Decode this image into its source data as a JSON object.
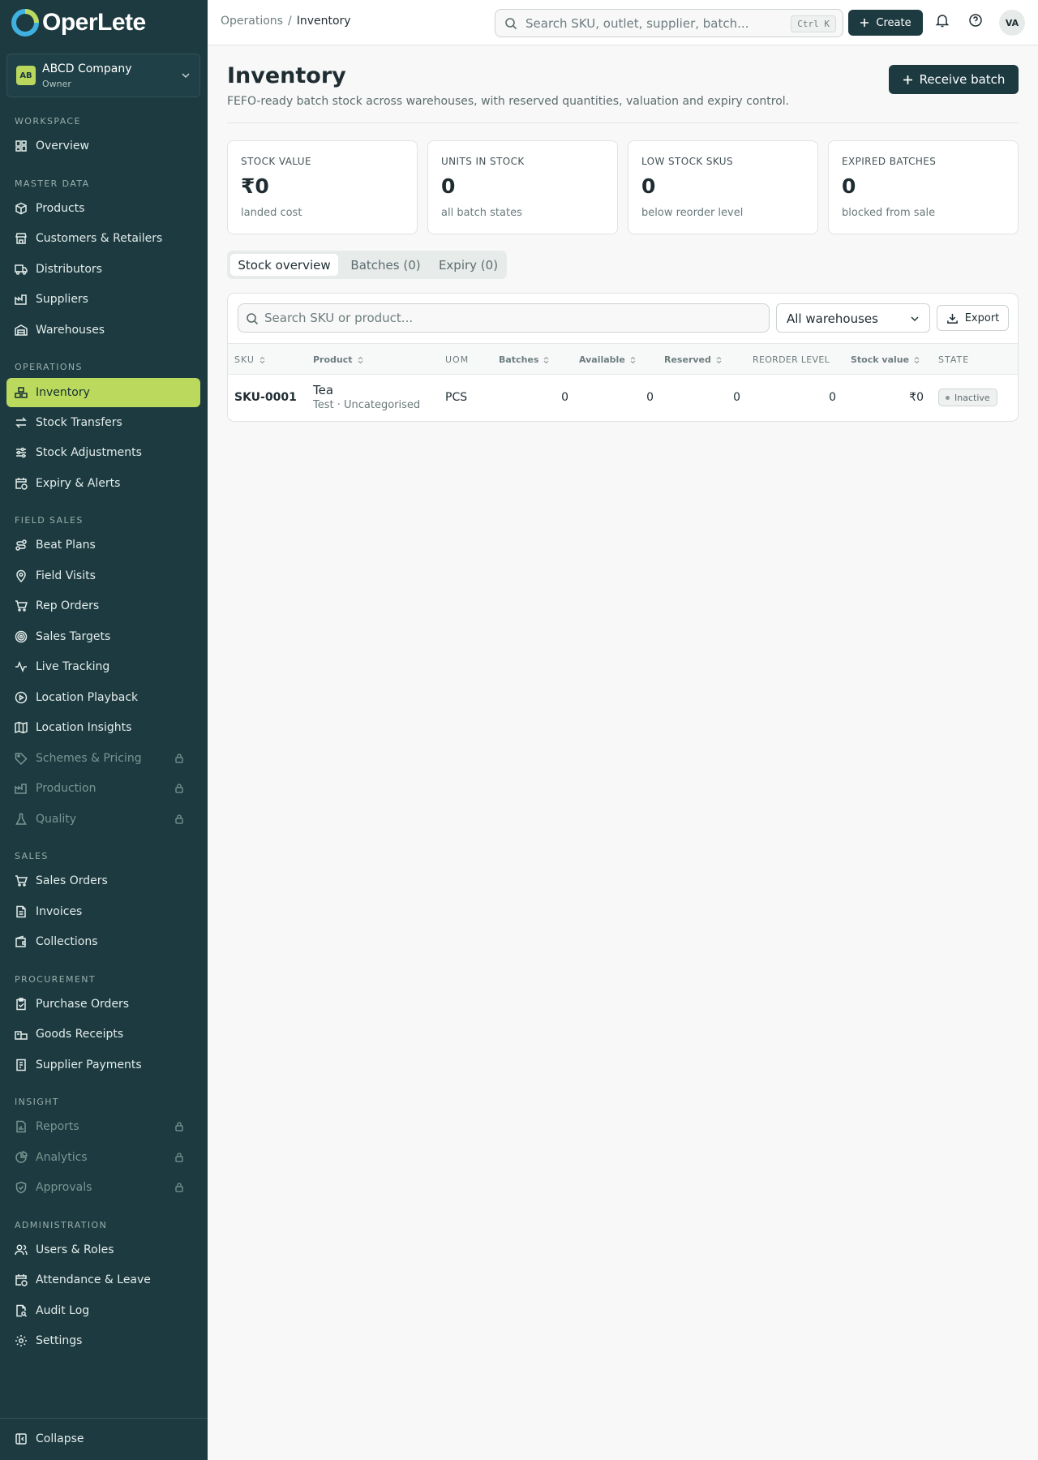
{
  "brand": {
    "name": "OperLete",
    "primary": "#1c3a40",
    "accent": "#bad95d"
  },
  "company": {
    "initials": "AB",
    "name": "ABCD Company",
    "role": "Owner"
  },
  "sidebar": {
    "sections": [
      {
        "title": "WORKSPACE",
        "items": [
          {
            "label": "Overview",
            "icon": "dashboard-icon"
          }
        ]
      },
      {
        "title": "MASTER DATA",
        "items": [
          {
            "label": "Products",
            "icon": "box-icon"
          },
          {
            "label": "Customers & Retailers",
            "icon": "store-icon"
          },
          {
            "label": "Distributors",
            "icon": "truck-icon"
          },
          {
            "label": "Suppliers",
            "icon": "factory-icon"
          },
          {
            "label": "Warehouses",
            "icon": "warehouse-icon"
          }
        ]
      },
      {
        "title": "OPERATIONS",
        "items": [
          {
            "label": "Inventory",
            "icon": "boxes-icon",
            "active": true
          },
          {
            "label": "Stock Transfers",
            "icon": "transfer-icon"
          },
          {
            "label": "Stock Adjustments",
            "icon": "sliders-icon"
          },
          {
            "label": "Expiry & Alerts",
            "icon": "calendar-clock-icon"
          }
        ]
      },
      {
        "title": "FIELD SALES",
        "items": [
          {
            "label": "Beat Plans",
            "icon": "route-icon"
          },
          {
            "label": "Field Visits",
            "icon": "map-pin-icon"
          },
          {
            "label": "Rep Orders",
            "icon": "cart-icon"
          },
          {
            "label": "Sales Targets",
            "icon": "target-icon"
          },
          {
            "label": "Live Tracking",
            "icon": "activity-icon"
          },
          {
            "label": "Location Playback",
            "icon": "play-circle-icon"
          },
          {
            "label": "Location Insights",
            "icon": "map-icon"
          },
          {
            "label": "Schemes & Pricing",
            "icon": "tag-icon",
            "locked": true
          },
          {
            "label": "Production",
            "icon": "factory-icon",
            "locked": true
          },
          {
            "label": "Quality",
            "icon": "flask-icon",
            "locked": true
          }
        ]
      },
      {
        "title": "SALES",
        "items": [
          {
            "label": "Sales Orders",
            "icon": "cart-icon"
          },
          {
            "label": "Invoices",
            "icon": "file-icon"
          },
          {
            "label": "Collections",
            "icon": "wallet-icon"
          }
        ]
      },
      {
        "title": "PROCUREMENT",
        "items": [
          {
            "label": "Purchase Orders",
            "icon": "clipboard-icon"
          },
          {
            "label": "Goods Receipts",
            "icon": "package-icon"
          },
          {
            "label": "Supplier Payments",
            "icon": "credit-card-icon"
          }
        ]
      },
      {
        "title": "INSIGHT",
        "items": [
          {
            "label": "Reports",
            "icon": "file-chart-icon",
            "locked": true
          },
          {
            "label": "Analytics",
            "icon": "pie-chart-icon",
            "locked": true
          },
          {
            "label": "Approvals",
            "icon": "shield-check-icon",
            "locked": true
          }
        ]
      },
      {
        "title": "ADMINISTRATION",
        "items": [
          {
            "label": "Users & Roles",
            "icon": "users-icon"
          },
          {
            "label": "Attendance & Leave",
            "icon": "calendar-check-icon"
          },
          {
            "label": "Audit Log",
            "icon": "file-search-icon"
          },
          {
            "label": "Settings",
            "icon": "gear-icon"
          }
        ]
      }
    ],
    "collapse": "Collapse"
  },
  "topbar": {
    "breadcrumb": [
      "Operations",
      "Inventory"
    ],
    "search_placeholder": "Search SKU, outlet, supplier, batch...",
    "shortcut": "Ctrl K",
    "create": "Create",
    "avatar": "VA"
  },
  "page": {
    "title": "Inventory",
    "subtitle": "FEFO-ready batch stock across warehouses, with reserved quantities, valuation and expiry control.",
    "receive": "Receive batch"
  },
  "kpis": [
    {
      "label": "STOCK VALUE",
      "value": "₹0",
      "hint": "landed cost"
    },
    {
      "label": "UNITS IN STOCK",
      "value": "0",
      "hint": "all batch states"
    },
    {
      "label": "LOW STOCK SKUS",
      "value": "0",
      "hint": "below reorder level"
    },
    {
      "label": "EXPIRED BATCHES",
      "value": "0",
      "hint": "blocked from sale"
    }
  ],
  "tabs": [
    "Stock overview",
    "Batches (0)",
    "Expiry (0)"
  ],
  "table": {
    "search_placeholder": "Search SKU or product...",
    "warehouse": "All warehouses",
    "export": "Export",
    "columns": [
      "SKU",
      "Product",
      "UOM",
      "Batches",
      "Available",
      "Reserved",
      "REORDER LEVEL",
      "Stock value",
      "STATE"
    ],
    "rows": [
      {
        "sku": "SKU-0001",
        "product": "Tea",
        "meta": "Test · Uncategorised",
        "uom": "PCS",
        "batches": "0",
        "available": "0",
        "reserved": "0",
        "reorder": "0",
        "value": "₹0",
        "state": "Inactive"
      }
    ]
  }
}
